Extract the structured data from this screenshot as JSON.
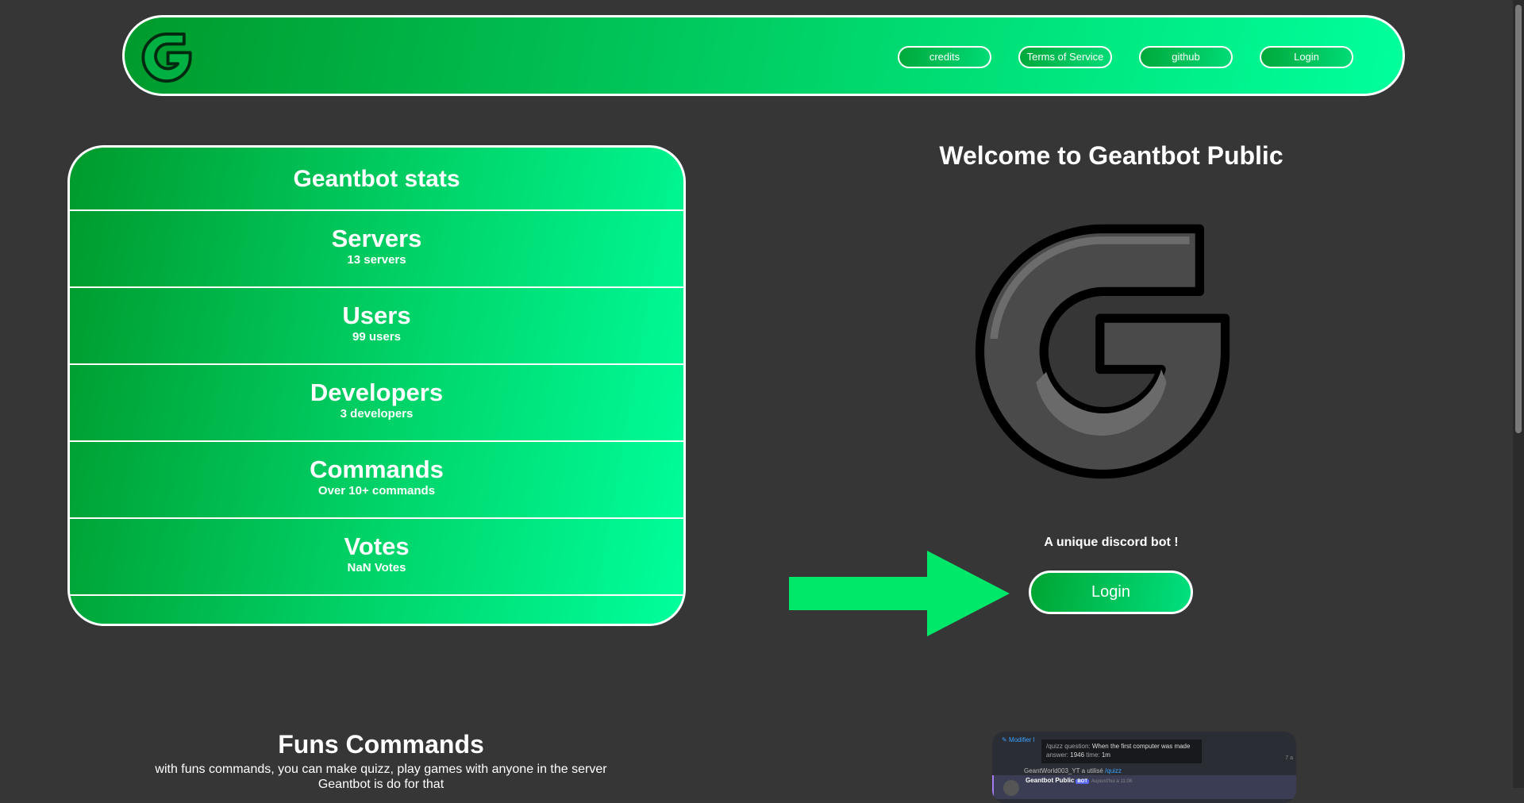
{
  "colors": {
    "background": "#363636",
    "accent_start": "#009a2c",
    "accent_end": "#00ff9c",
    "arrow": "#00e86a"
  },
  "header": {
    "logo_icon": "geantbot-logo-icon",
    "nav": [
      "credits",
      "Terms of Service",
      "github",
      "Login"
    ]
  },
  "stats": {
    "title": "Geantbot stats",
    "rows": [
      {
        "label": "Servers",
        "value": "13 servers"
      },
      {
        "label": "Users",
        "value": "99 users"
      },
      {
        "label": "Developers",
        "value": "3 developers"
      },
      {
        "label": "Commands",
        "value": "Over 10+ commands"
      },
      {
        "label": "Votes",
        "value": "NaN Votes"
      }
    ]
  },
  "welcome": {
    "title": "Welcome to Geantbot Public",
    "tagline": "A unique discord bot !",
    "login_label": "Login"
  },
  "funs": {
    "title": "Funs Commands",
    "line1": "with funs commands, you can make quizz, play games with anyone in the server",
    "line2": "Geantbot is do for that"
  },
  "discord_preview": {
    "edit_label": "Modifier l",
    "tooltip_cmd": "/quizz",
    "tooltip_q_label": "question:",
    "tooltip_question": "When the first computer was made",
    "tooltip_a_label": "answer:",
    "tooltip_answer": "1946",
    "tooltip_t_label": "time:",
    "tooltip_time": "1m",
    "time": "7 a",
    "user": "GeantWorld003_YT",
    "used_text": "a utilisé",
    "used_cmd": "/quizz",
    "bot_name": "Geantbot Public",
    "bot_badge": "BOT",
    "bot_date": "Aujourd'hui à 11:08"
  }
}
